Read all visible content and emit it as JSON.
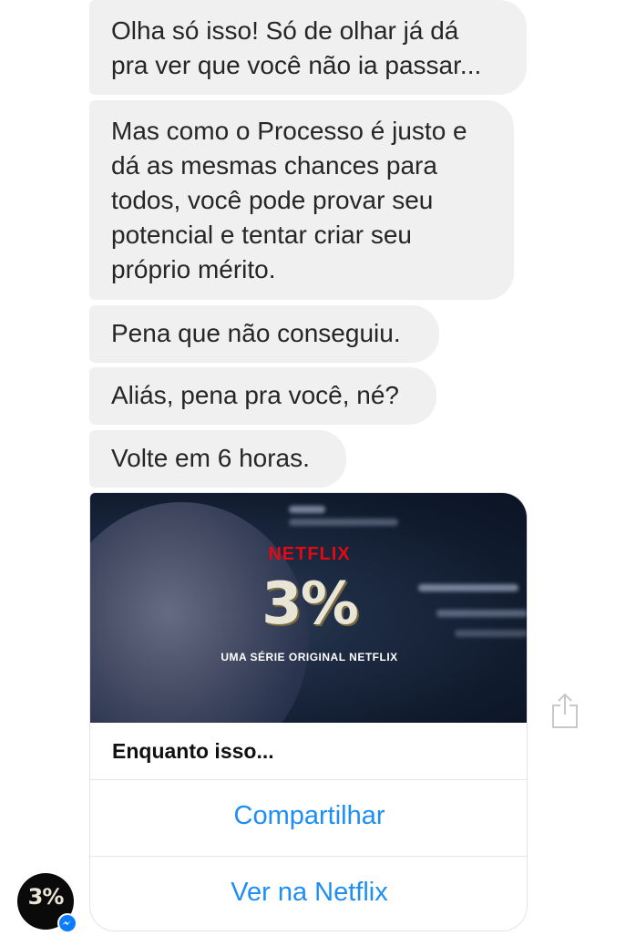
{
  "messages": [
    {
      "text": "Olha só isso! Só de olhar já dá\npra ver que você não ia passar..."
    },
    {
      "text": "Mas como o Processo é justo e\ndá as mesmas chances para\ntodos, você pode provar seu\npotencial e tentar criar seu\npróprio mérito."
    },
    {
      "text": "Pena que não conseguiu."
    },
    {
      "text": "Aliás, pena pra você, né?"
    },
    {
      "text": "Volte em 6 horas."
    }
  ],
  "card": {
    "brand": "NETFLIX",
    "logo": "3%",
    "tagline": "UMA SÉRIE ORIGINAL NETFLIX",
    "title": "Enquanto isso...",
    "buttons": [
      {
        "label": "Compartilhar"
      },
      {
        "label": "Ver na Netflix"
      }
    ]
  },
  "icons": {
    "share": "share-icon",
    "messenger_badge": "messenger-icon"
  },
  "colors": {
    "bubble_bg": "#f1f0f0",
    "link_blue": "#1d8ef5",
    "netflix_red": "#e50914",
    "messenger_blue": "#0a7cff"
  },
  "avatar": {
    "logo": "3%"
  }
}
